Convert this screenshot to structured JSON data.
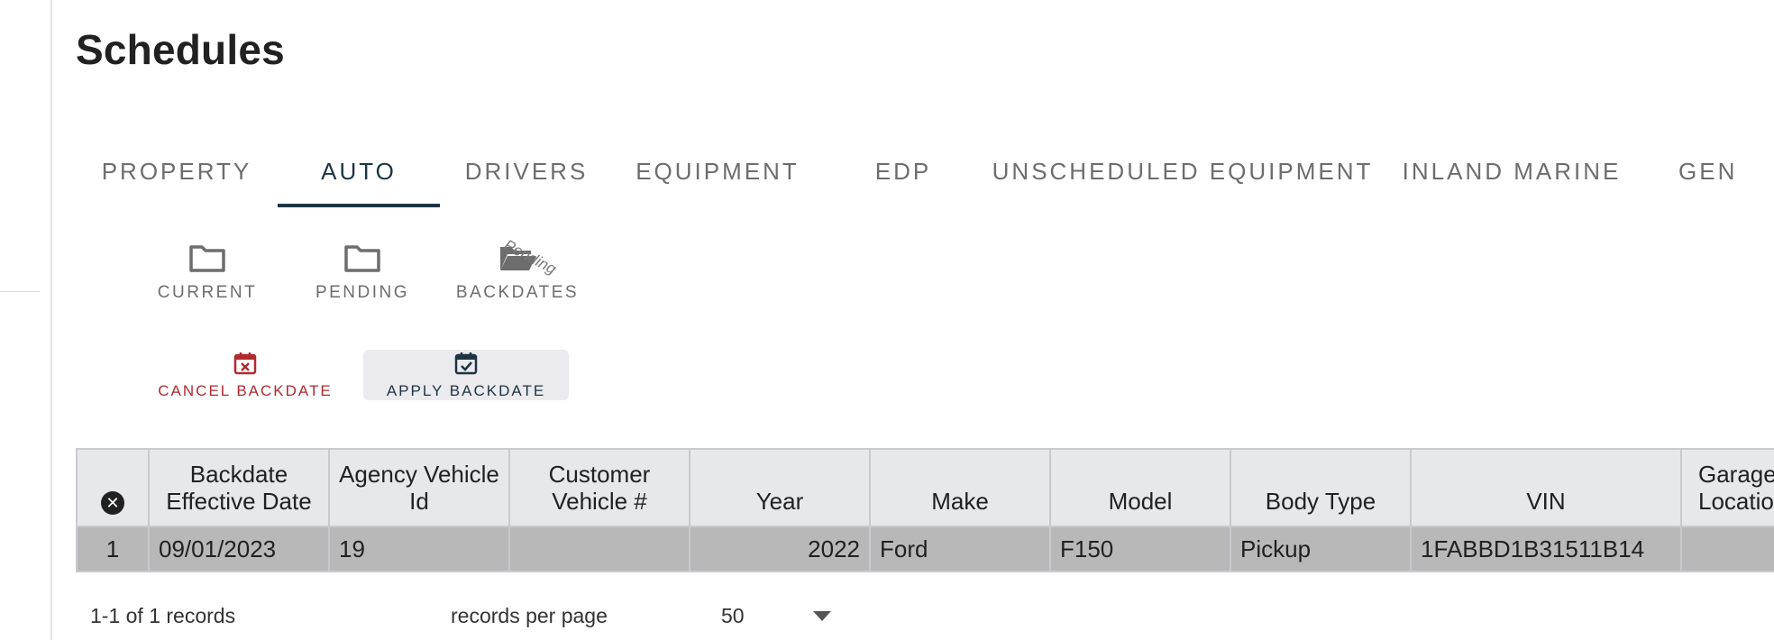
{
  "page": {
    "title": "Schedules"
  },
  "tabs": [
    {
      "label": "PROPERTY"
    },
    {
      "label": "AUTO",
      "active": true
    },
    {
      "label": "DRIVERS"
    },
    {
      "label": "EQUIPMENT"
    },
    {
      "label": "EDP"
    },
    {
      "label": "UNSCHEDULED EQUIPMENT"
    },
    {
      "label": "INLAND MARINE"
    },
    {
      "label": "GEN"
    }
  ],
  "views": {
    "current": {
      "label": "CURRENT",
      "icon": "folder-icon"
    },
    "pending": {
      "label": "PENDING",
      "icon": "folder-icon"
    },
    "backdates": {
      "label": "BACKDATES",
      "icon": "folder-open-icon",
      "badge": "Pending"
    }
  },
  "actions": {
    "cancel": {
      "label": "CANCEL BACKDATE",
      "icon": "calendar-x-icon",
      "color": "#b02a2f"
    },
    "apply": {
      "label": "APPLY BACKDATE",
      "icon": "calendar-check-icon",
      "color": "#1d3442"
    }
  },
  "table": {
    "clear_icon": "clear-filter-icon",
    "headers": {
      "backdate": "Backdate Effective Date",
      "agency_id": "Agency Vehicle Id",
      "customer_no": "Customer Vehicle #",
      "year": "Year",
      "make": "Make",
      "model": "Model",
      "body": "Body Type",
      "vin": "VIN",
      "garage": "Garage Location"
    },
    "rows": [
      {
        "row_no": "1",
        "backdate": "09/01/2023",
        "agency_id": "19",
        "customer_no": "",
        "year": "2022",
        "make": "Ford",
        "model": "F150",
        "body": "Pickup",
        "vin": "1FABBD1B31511B14",
        "garage": ""
      }
    ]
  },
  "pagination": {
    "summary": "1-1 of 1 records",
    "per_page_label": "records per page",
    "per_page_value": "50"
  },
  "colors": {
    "accent": "#1d3442",
    "danger": "#b02a2f",
    "header_bg": "#e7e8ec",
    "row_selected_bg": "#b8b8b8"
  }
}
